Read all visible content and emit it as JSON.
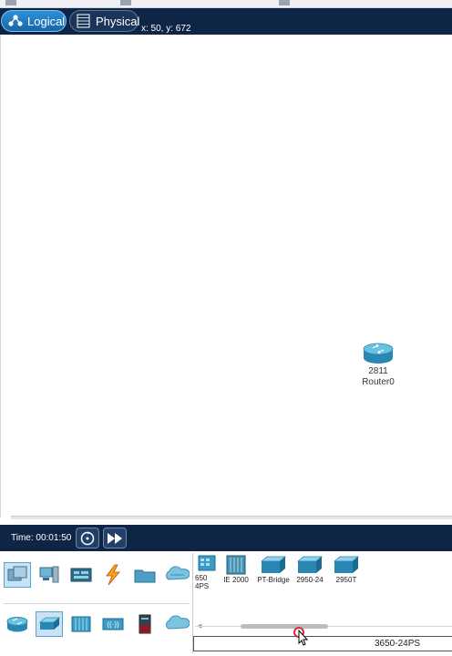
{
  "modes": {
    "logical_label": "Logical",
    "physical_label": "Physical",
    "active": "Logical"
  },
  "coordinates": "x: 50, y: 672",
  "workspace": {
    "devices": [
      {
        "model": "2811",
        "name": "Router0",
        "icon": "router-icon"
      }
    ]
  },
  "simulation": {
    "time_label": "Time: 00:01:50",
    "reset_icon": "reset-icon",
    "fast_forward_icon": "fast-forward-icon"
  },
  "palette": {
    "top_categories": [
      {
        "icon": "network-devices-icon",
        "selected": true
      },
      {
        "icon": "end-devices-icon",
        "selected": false
      },
      {
        "icon": "components-icon",
        "selected": false
      },
      {
        "icon": "connections-icon",
        "selected": false
      },
      {
        "icon": "miscellaneous-icon",
        "selected": false
      },
      {
        "icon": "multiuser-icon",
        "selected": false
      }
    ],
    "sub_categories": [
      {
        "icon": "routers-icon",
        "selected": false
      },
      {
        "icon": "switches-icon",
        "selected": true
      },
      {
        "icon": "hubs-icon",
        "selected": false
      },
      {
        "icon": "wireless-icon",
        "selected": false
      },
      {
        "icon": "security-icon",
        "selected": false
      },
      {
        "icon": "wan-emulation-icon",
        "selected": false
      }
    ],
    "switch_models": [
      {
        "label": "650\n4PS"
      },
      {
        "label": "IE 2000"
      },
      {
        "label": "PT-Bridge"
      },
      {
        "label": "2950-24"
      },
      {
        "label": "2950T"
      }
    ],
    "selected_model": "3650-24PS"
  },
  "colors": {
    "bar": "#0f2546",
    "accent": "#2f90d6",
    "device": "#3a9bc4"
  }
}
